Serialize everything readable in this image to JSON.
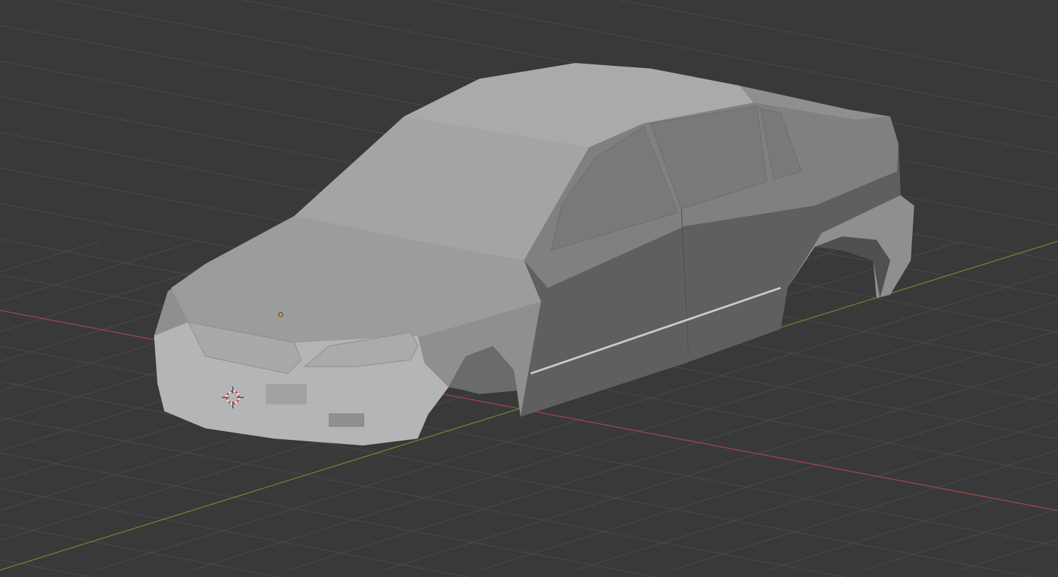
{
  "viewport": {
    "background_color": "#393939",
    "grid_color": "#4b4b4b",
    "x_axis_color": "#a9434a",
    "y_axis_color": "#6a8a2e",
    "origin_color": "#e8962f"
  },
  "model": {
    "body_light": "#a4a6a7",
    "body_mid": "#8d8f90",
    "body_dark": "#5f5f60",
    "glass": "#7a7c7d"
  }
}
